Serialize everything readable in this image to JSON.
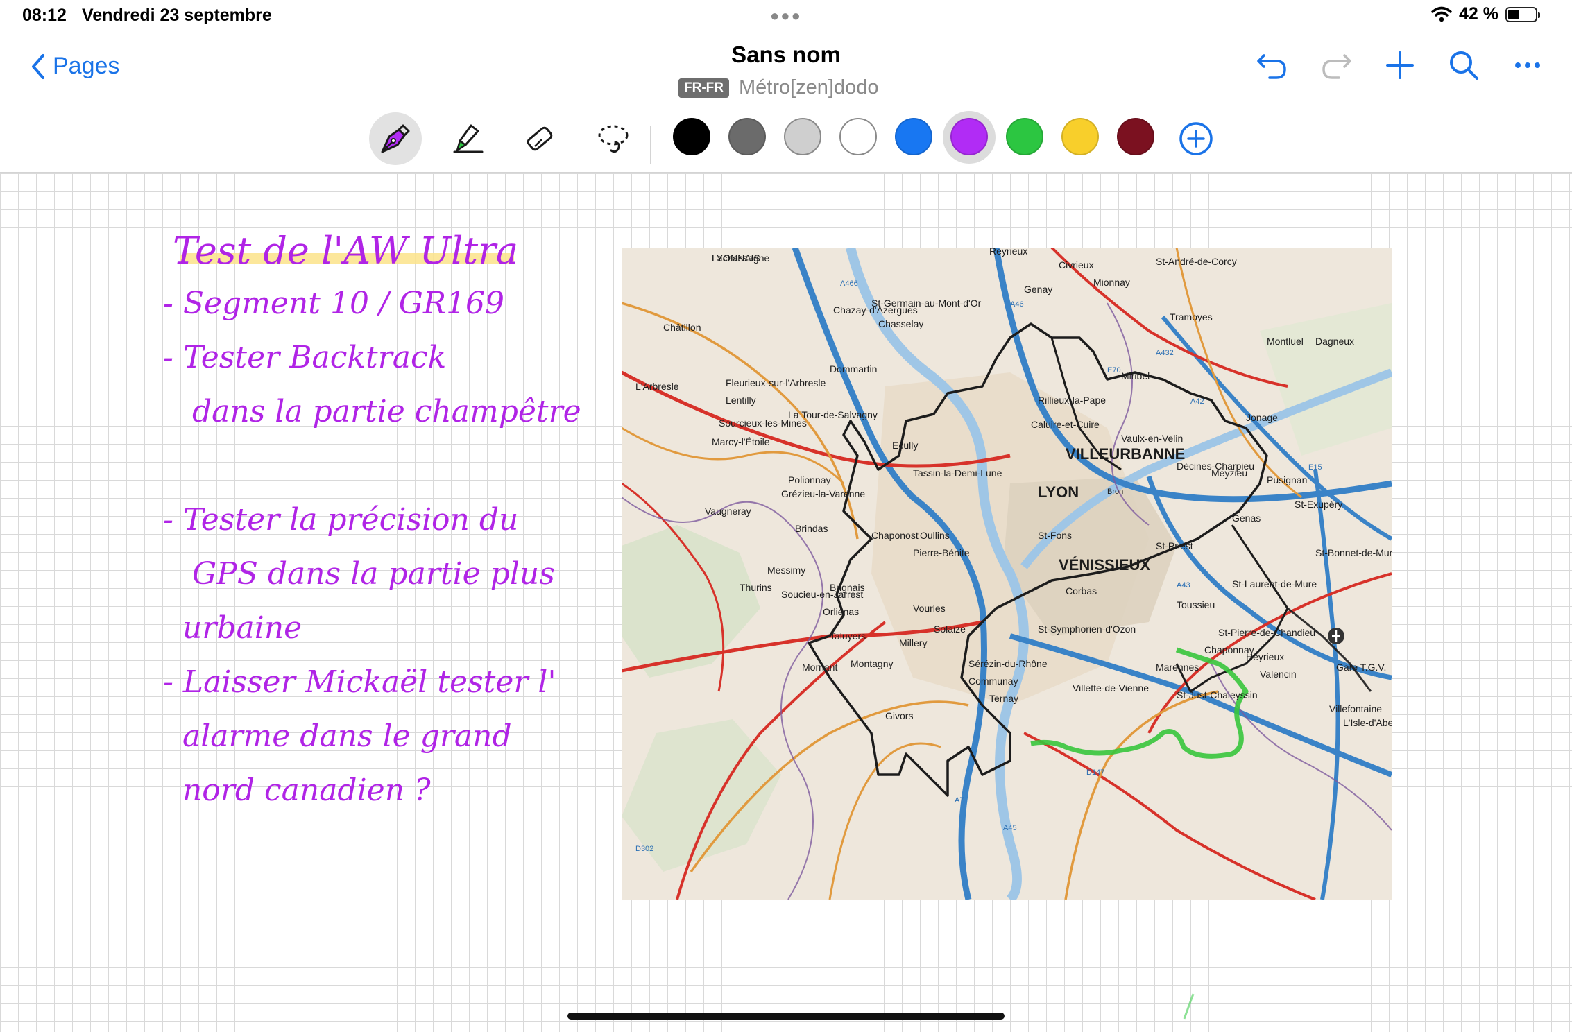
{
  "status": {
    "time": "08:12",
    "date": "Vendredi 23 septembre",
    "battery_text": "42 %",
    "battery_level": 0.42
  },
  "nav": {
    "back_label": "Pages",
    "title": "Sans nom",
    "language": "FR-FR",
    "notebook": "Métro[zen]dodo"
  },
  "toolbar": {
    "tools": [
      "pen-icon",
      "highlighter-icon",
      "eraser-icon",
      "lasso-icon"
    ],
    "selected_tool": "pen",
    "colors": [
      "#000000",
      "#6b6b6b",
      "#cfcfcf",
      "#ffffff",
      "#1877f2",
      "#b12cf5",
      "#2cc641",
      "#f8cf2b",
      "#7b1120"
    ],
    "selected_color": "#b12cf5"
  },
  "notes": {
    "title": "Test de l'AW Ultra",
    "lines": [
      "- Segment 10 / GR169",
      "- Tester Backtrack",
      "   dans la partie champêtre",
      "",
      "- Tester la précision du",
      "   GPS dans la partie plus",
      "  urbaine",
      "- Laisser Mickaël tester l'",
      "  alarme dans le grand",
      "  nord canadien ?"
    ],
    "ink_color": "#b024e6",
    "highlight_color": "#fbe38a"
  },
  "map": {
    "labels": [
      "Lachassagne",
      "Reyrieux",
      "Civrieux",
      "St-André-de-Corcy",
      "Genay",
      "Mionnay",
      "Tramoyes",
      "Chazay-d'Azergues",
      "St-Germain-au-Mont-d'Or",
      "Chasselay",
      "Montluel",
      "Dagneux",
      "Châtillon",
      "Dommartin",
      "Miribel",
      "L'Arbresle",
      "Lentilly",
      "Rillieux-la-Pape",
      "Fleurieux-sur-l'Arbresle",
      "Sourcieux-les-Mines",
      "La Tour-de-Salvagny",
      "Caluire-et-Cuire",
      "Jonage",
      "Vaulx-en-Velin",
      "Ecully",
      "VILLEURBANNE",
      "Décines-Charpieu",
      "Meyzieu",
      "Pusignan",
      "Marcy-l'Étoile",
      "Tassin-la-Demi-Lune",
      "LYON",
      "Bron",
      "Polionnay",
      "Grézieu-la-Varenne",
      "Vaugneray",
      "Brindas",
      "Genas",
      "St-Exupéry",
      "Gare T.G.V.",
      "Chaponost",
      "Oullins",
      "Pierre-Bénite",
      "St-Fons",
      "St-Priest",
      "St-Bonnet-de-Mure",
      "VÉNISSIEUX",
      "St-Laurent-de-Mure",
      "Messimy",
      "Thurins",
      "Soucieu-en-Jarrest",
      "Brignais",
      "Orliénas",
      "Vourles",
      "Corbas",
      "Toussieu",
      "Taluyers",
      "Millery",
      "Solaize",
      "St-Symphorien-d'Ozon",
      "St-Pierre-de-Chandieu",
      "Chaponnay",
      "Mornant",
      "Montagny",
      "Marennes",
      "Sérézin-du-Rhône",
      "Communay",
      "Villette-de-Vienne",
      "St-Just-Chaleyssin",
      "Valencin",
      "Heyrieux",
      "Ternay",
      "Givors",
      "Villefontaine",
      "L'Isle-d'Abeau",
      "A466",
      "A46",
      "A432",
      "A42",
      "E70",
      "A43",
      "A7",
      "A45",
      "E15",
      "D147",
      "D302",
      "LYONNAIS"
    ],
    "route_colors": {
      "black_track": "#1c1c1c",
      "green_track": "#37c53c",
      "motorway": "#3a83c7",
      "main_road": "#d7322a",
      "secondary_road": "#e19a3e"
    }
  }
}
